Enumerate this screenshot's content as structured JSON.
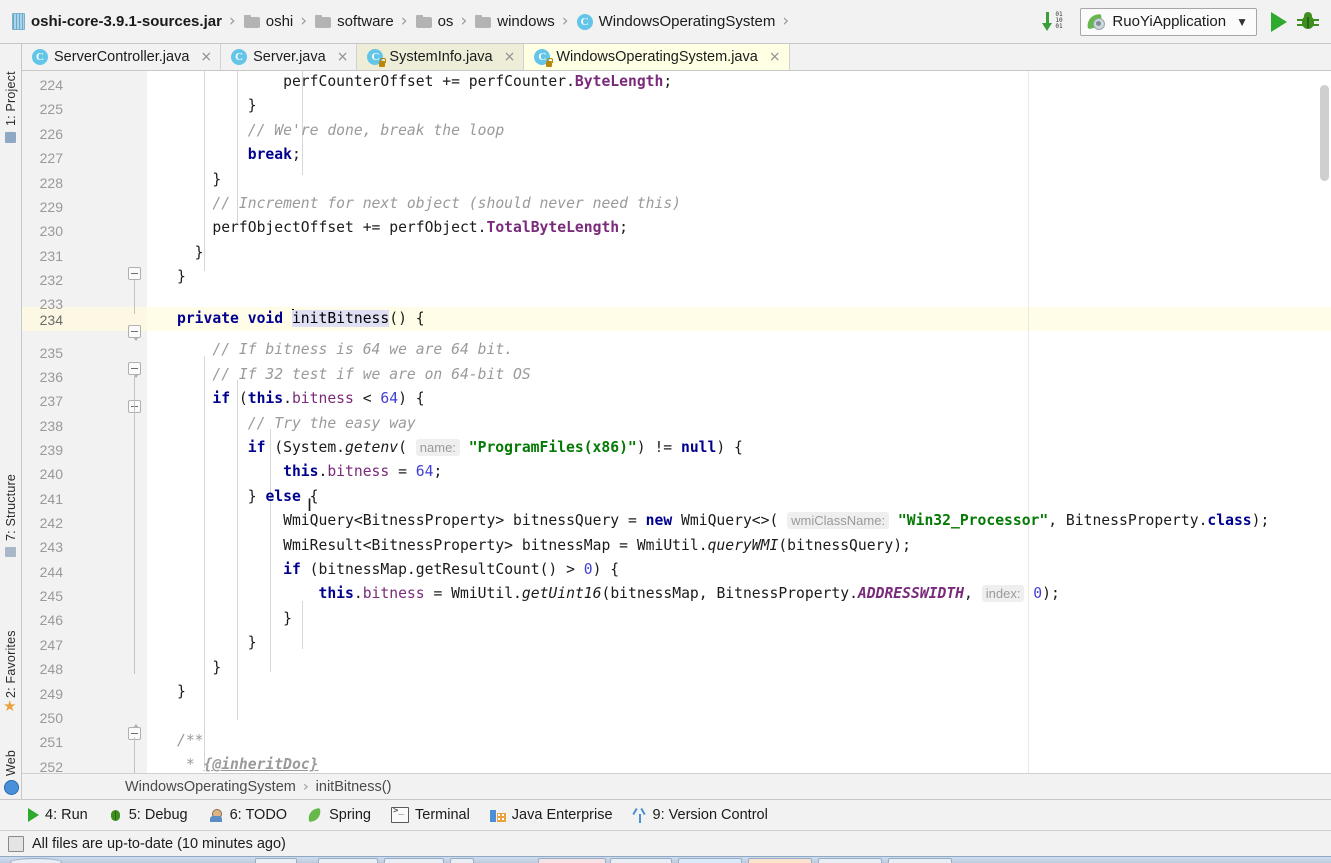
{
  "navbar": {
    "breadcrumbs": [
      {
        "label": "oshi-core-3.9.1-sources.jar",
        "icon": "jar-icon"
      },
      {
        "label": "oshi",
        "icon": "folder-icon"
      },
      {
        "label": "software",
        "icon": "folder-icon"
      },
      {
        "label": "os",
        "icon": "folder-icon"
      },
      {
        "label": "windows",
        "icon": "folder-icon"
      },
      {
        "label": "WindowsOperatingSystem",
        "icon": "class-icon"
      }
    ],
    "separator": "›",
    "class_icon_letter": "C",
    "run_config": "RuoYiApplication",
    "chevron": "⌄",
    "icons": {
      "update": "download-update-icon",
      "run": "run-icon",
      "debug": "debug-icon"
    }
  },
  "tabs": [
    {
      "label": "ServerController.java",
      "state": "plain",
      "close": "×",
      "letter": "C",
      "locked": false
    },
    {
      "label": "Server.java",
      "state": "plain",
      "close": "×",
      "letter": "C",
      "locked": false
    },
    {
      "label": "SystemInfo.java",
      "state": "recent",
      "close": "×",
      "letter": "C",
      "locked": true
    },
    {
      "label": "WindowsOperatingSystem.java",
      "state": "active",
      "close": "×",
      "letter": "C",
      "locked": true
    }
  ],
  "left_tool_window": [
    {
      "label": "1: Project",
      "icon": "project-icon"
    },
    {
      "label": "7: Structure",
      "icon": "structure-icon"
    },
    {
      "label": "2: Favorites",
      "icon": "favorites-star-icon"
    },
    {
      "label": "Web",
      "icon": "web-globe-icon"
    }
  ],
  "editor": {
    "first_line": 224,
    "last_line": 252,
    "highlighted_line": 234,
    "selection_text": "initBitness",
    "lines": [
      {
        "n": 224,
        "tokens": [
          {
            "t": "            perfCounterOffset += perfCounter.",
            "c": "pl"
          },
          {
            "t": "ByteLength",
            "c": "cfld"
          },
          {
            "t": ";",
            "c": "pl"
          }
        ]
      },
      {
        "n": 225,
        "tokens": [
          {
            "t": "        }",
            "c": "pl"
          }
        ]
      },
      {
        "n": 226,
        "tokens": [
          {
            "t": "        // We're done, break the loop",
            "c": "cm"
          }
        ]
      },
      {
        "n": 227,
        "tokens": [
          {
            "t": "        ",
            "c": "pl"
          },
          {
            "t": "break",
            "c": "kw"
          },
          {
            "t": ";",
            "c": "pl"
          }
        ]
      },
      {
        "n": 228,
        "tokens": [
          {
            "t": "    }",
            "c": "pl"
          }
        ]
      },
      {
        "n": 229,
        "tokens": [
          {
            "t": "    // Increment for next object (should never need this)",
            "c": "cm"
          }
        ]
      },
      {
        "n": 230,
        "tokens": [
          {
            "t": "    perfObjectOffset += perfObject.",
            "c": "pl"
          },
          {
            "t": "TotalByteLength",
            "c": "cfld"
          },
          {
            "t": ";",
            "c": "pl"
          }
        ]
      },
      {
        "n": 231,
        "tokens": [
          {
            "t": "  }",
            "c": "pl"
          }
        ]
      },
      {
        "n": 232,
        "tokens": [
          {
            "t": "}",
            "c": "pl"
          }
        ]
      },
      {
        "n": 233,
        "tokens": []
      },
      {
        "n": 234,
        "tokens": [
          {
            "t": "private void ",
            "c": "kw"
          },
          {
            "t": "initBitness",
            "c": "sel"
          },
          {
            "t": "() {",
            "c": "pl"
          }
        ]
      },
      {
        "n": 235,
        "tokens": [
          {
            "t": "    // If bitness is 64 we are 64 bit.",
            "c": "cm"
          }
        ]
      },
      {
        "n": 236,
        "tokens": [
          {
            "t": "    // If 32 test if we are on 64-bit OS",
            "c": "cm"
          }
        ]
      },
      {
        "n": 237,
        "tokens": [
          {
            "t": "    ",
            "c": "pl"
          },
          {
            "t": "if",
            "c": "kw"
          },
          {
            "t": " (",
            "c": "pl"
          },
          {
            "t": "this",
            "c": "kw"
          },
          {
            "t": ".",
            "c": "pl"
          },
          {
            "t": "bitness",
            "c": "fld"
          },
          {
            "t": " < ",
            "c": "pl"
          },
          {
            "t": "64",
            "c": "num"
          },
          {
            "t": ") {",
            "c": "pl"
          }
        ]
      },
      {
        "n": 238,
        "tokens": [
          {
            "t": "        // Try the easy way",
            "c": "cm"
          }
        ]
      },
      {
        "n": 239,
        "tokens": [
          {
            "t": "        ",
            "c": "pl"
          },
          {
            "t": "if",
            "c": "kw"
          },
          {
            "t": " (System.",
            "c": "pl"
          },
          {
            "t": "getenv",
            "c": "mth"
          },
          {
            "t": "( ",
            "c": "pl"
          },
          {
            "t": "name:",
            "c": "hint"
          },
          {
            "t": " ",
            "c": "pl"
          },
          {
            "t": "\"ProgramFiles(x86)\"",
            "c": "str"
          },
          {
            "t": ") != ",
            "c": "pl"
          },
          {
            "t": "null",
            "c": "kw"
          },
          {
            "t": ") {",
            "c": "pl"
          }
        ]
      },
      {
        "n": 240,
        "tokens": [
          {
            "t": "            ",
            "c": "pl"
          },
          {
            "t": "this",
            "c": "kw"
          },
          {
            "t": ".",
            "c": "pl"
          },
          {
            "t": "bitness",
            "c": "fld"
          },
          {
            "t": " = ",
            "c": "pl"
          },
          {
            "t": "64",
            "c": "num"
          },
          {
            "t": ";",
            "c": "pl"
          }
        ]
      },
      {
        "n": 241,
        "tokens": [
          {
            "t": "        } ",
            "c": "pl"
          },
          {
            "t": "else",
            "c": "kw"
          },
          {
            "t": " {",
            "c": "pl"
          }
        ]
      },
      {
        "n": 242,
        "tokens": [
          {
            "t": "            WmiQuery<BitnessProperty> bitnessQuery = ",
            "c": "pl"
          },
          {
            "t": "new",
            "c": "kw"
          },
          {
            "t": " WmiQuery<>( ",
            "c": "pl"
          },
          {
            "t": "wmiClassName:",
            "c": "hint"
          },
          {
            "t": " ",
            "c": "pl"
          },
          {
            "t": "\"Win32_Processor\"",
            "c": "str"
          },
          {
            "t": ", BitnessProperty.",
            "c": "pl"
          },
          {
            "t": "class",
            "c": "kw"
          },
          {
            "t": ");",
            "c": "pl"
          }
        ]
      },
      {
        "n": 243,
        "tokens": [
          {
            "t": "            WmiResult<BitnessProperty> bitnessMap = WmiUtil.",
            "c": "pl"
          },
          {
            "t": "queryWMI",
            "c": "mth"
          },
          {
            "t": "(bitnessQuery);",
            "c": "pl"
          }
        ]
      },
      {
        "n": 244,
        "tokens": [
          {
            "t": "            ",
            "c": "pl"
          },
          {
            "t": "if",
            "c": "kw"
          },
          {
            "t": " (bitnessMap.getResultCount() > ",
            "c": "pl"
          },
          {
            "t": "0",
            "c": "num"
          },
          {
            "t": ") {",
            "c": "pl"
          }
        ]
      },
      {
        "n": 245,
        "tokens": [
          {
            "t": "                ",
            "c": "pl"
          },
          {
            "t": "this",
            "c": "kw"
          },
          {
            "t": ".",
            "c": "pl"
          },
          {
            "t": "bitness",
            "c": "fld"
          },
          {
            "t": " = WmiUtil.",
            "c": "pl"
          },
          {
            "t": "getUint16",
            "c": "mth"
          },
          {
            "t": "(bitnessMap, BitnessProperty.",
            "c": "pl"
          },
          {
            "t": "ADDRESSWIDTH",
            "c": "sfld"
          },
          {
            "t": ", ",
            "c": "pl"
          },
          {
            "t": "index:",
            "c": "hint"
          },
          {
            "t": " ",
            "c": "pl"
          },
          {
            "t": "0",
            "c": "num"
          },
          {
            "t": ");",
            "c": "pl"
          }
        ]
      },
      {
        "n": 246,
        "tokens": [
          {
            "t": "            }",
            "c": "pl"
          }
        ]
      },
      {
        "n": 247,
        "tokens": [
          {
            "t": "        }",
            "c": "pl"
          }
        ]
      },
      {
        "n": 248,
        "tokens": [
          {
            "t": "    }",
            "c": "pl"
          }
        ]
      },
      {
        "n": 249,
        "tokens": [
          {
            "t": "}",
            "c": "pl"
          }
        ]
      },
      {
        "n": 250,
        "tokens": []
      },
      {
        "n": 251,
        "tokens": [
          {
            "t": "/**",
            "c": "cm"
          }
        ]
      },
      {
        "n": 252,
        "tokens": [
          {
            "t": " * {@inheritDoc}",
            "c": "cm"
          }
        ]
      }
    ]
  },
  "editor_breadcrumb": {
    "class": "WindowsOperatingSystem",
    "separator": "›",
    "method": "initBitness()"
  },
  "bottom_toolbar": [
    {
      "label": "4: Run",
      "icon": "run-icon",
      "mnemonic": "4"
    },
    {
      "label": "5: Debug",
      "icon": "debug-icon",
      "mnemonic": "5"
    },
    {
      "label": "6: TODO",
      "icon": "todo-icon",
      "mnemonic": "6"
    },
    {
      "label": "Spring",
      "icon": "spring-leaf-icon",
      "mnemonic": ""
    },
    {
      "label": "Terminal",
      "icon": "terminal-icon",
      "mnemonic": ""
    },
    {
      "label": "Java Enterprise",
      "icon": "java-enterprise-icon",
      "mnemonic": ""
    },
    {
      "label": "9: Version Control",
      "icon": "version-control-icon",
      "mnemonic": "9"
    }
  ],
  "statusbar": {
    "message": "All files are up-to-date (10 minutes ago)",
    "icon": "vcs-status-icon"
  },
  "colors": {
    "accent_green": "#2eaa2e",
    "highlight_line": "#fffde7",
    "tab_active": "#ffffe4",
    "tab_recent": "#ededd8",
    "chrome": "#f2f2f2",
    "string_green": "#047a04",
    "keyword_blue": "#00008f",
    "field_purple": "#7a2a7a"
  }
}
